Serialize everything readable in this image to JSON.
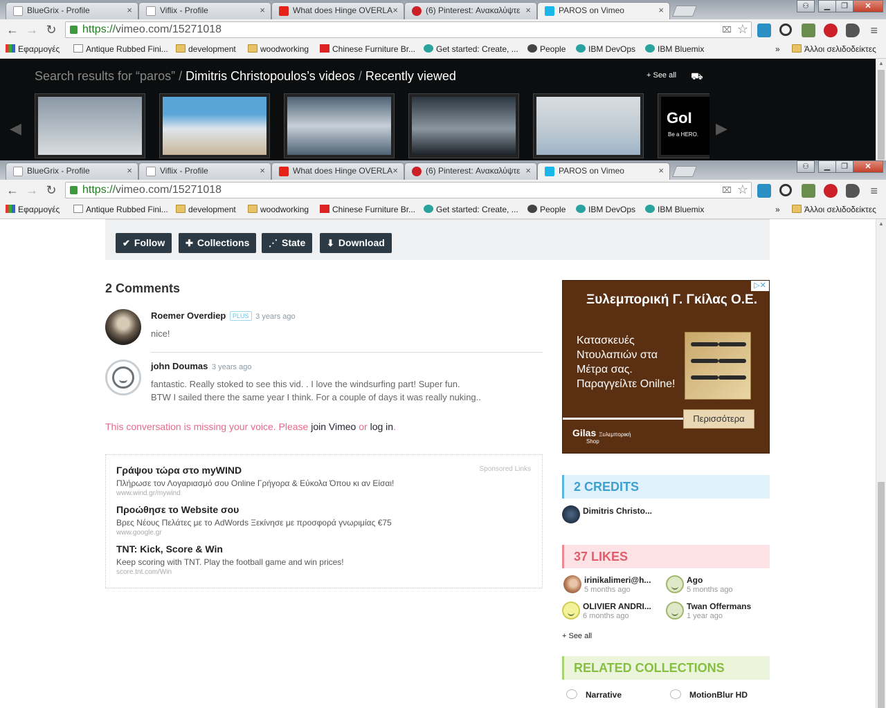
{
  "browser": {
    "tabs": [
      {
        "title": "BlueGrix - Profile",
        "favicon": "page-icon",
        "color": "#ffffff"
      },
      {
        "title": "Viflix - Profile",
        "favicon": "page-icon",
        "color": "#ffffff"
      },
      {
        "title": "What does Hinge OVERLA",
        "favicon": "youtube-icon",
        "color": "#e62117"
      },
      {
        "title": "(6) Pinterest: Ανακαλύψτε",
        "favicon": "pinterest-icon",
        "color": "#cb2027"
      },
      {
        "title": "PAROS on Vimeo",
        "favicon": "vimeo-icon",
        "color": "#1ab7ea"
      }
    ],
    "tab_close": "×",
    "url_scheme": "https://",
    "url_rest": "vimeo.com/15271018",
    "bookmarks": [
      {
        "label": "Εφαρμογές",
        "icon": "apps-icon"
      },
      {
        "label": "Antique Rubbed Fini...",
        "icon": "page-icon"
      },
      {
        "label": "development",
        "icon": "folder-icon"
      },
      {
        "label": "woodworking",
        "icon": "folder-icon"
      },
      {
        "label": "Chinese Furniture Br...",
        "icon": "bookmark-red-icon"
      },
      {
        "label": "Get started: Create, ...",
        "icon": "ibm-icon"
      },
      {
        "label": "People",
        "icon": "github-icon"
      },
      {
        "label": "IBM DevOps",
        "icon": "ibm-icon"
      },
      {
        "label": "IBM Bluemix",
        "icon": "ibm-icon"
      }
    ],
    "bookmarks_overflow": "»",
    "other_bookmarks": "Άλλοι σελιδοδείκτες"
  },
  "carousel": {
    "crumb_1": "Search results for “paros”",
    "sep": " / ",
    "crumb_2": "Dimitris Christopoulos’s videos",
    "crumb_3": "Recently viewed",
    "see_all": "+ See all",
    "thumbs": [
      {
        "name": "paros-town",
        "colors": [
          "#8a98a6",
          "#d9dde0"
        ]
      },
      {
        "name": "windsurf-girls",
        "colors": [
          "#5aa5d8",
          "#c9b79a"
        ]
      },
      {
        "name": "cloudy-sky",
        "colors": [
          "#4e6274",
          "#c7d0d8"
        ]
      },
      {
        "name": "windmill-dusk",
        "colors": [
          "#2b3640",
          "#8a96a0"
        ]
      },
      {
        "name": "beach-blur",
        "colors": [
          "#d7dde2",
          "#9eb4c7"
        ]
      },
      {
        "name": "gopro-ad",
        "colors": [
          "#000000",
          "#1a1a1a"
        ]
      }
    ],
    "gopro_text": "GoI",
    "gopro_sub": "Be a HERO."
  },
  "actions": {
    "follow": "Follow",
    "collections": "Collections",
    "state": "State",
    "download": "Download"
  },
  "comments": {
    "heading": "2 Comments",
    "items": [
      {
        "author": "Roemer Overdiep",
        "badge": "PLUS",
        "time": "3 years ago",
        "text": "nice!"
      },
      {
        "author": "john Doumas",
        "time": "3 years ago",
        "text_1": "fantastic. Really stoked to see this vid. . I love the windsurfing part! Super fun.",
        "text_2": "BTW I sailed there the same year I think. For a couple of days it was really nuking.."
      }
    ],
    "voice_prefix": "This conversation is missing your voice. Please",
    "join": "join Vimeo",
    "or": "or",
    "login": "log in",
    "dot": "."
  },
  "sponsored": {
    "tag": "Sponsored Links",
    "ads": [
      {
        "title": "Γράψου τώρα στο myWIND",
        "desc": "Πλήρωσε τον Λογαριασμό σου Online Γρήγορα & Εύκολα Όπου κι αν Είσαι!",
        "url": "www.wind.gr/mywind"
      },
      {
        "title": "Προώθησε το Website σου",
        "desc": "Βρες Νέους Πελάτες με το AdWords Ξεκίνησε με προσφορά γνωριμίας €75",
        "url": "www.google.gr"
      },
      {
        "title": "TNT: Kick, Score & Win",
        "desc": "Keep scoring with TNT. Play the football game and win prices!",
        "url": "score.tnt.com/Win"
      }
    ]
  },
  "banner": {
    "title": "Ξυλεμπορική Γ. Γκίλας Ο.Ε.",
    "body": "Κατασκευές Ντουλαπιών στα Μέτρα σας. Παραγγείλτε Onilne!",
    "more": "Περισσότερα",
    "logo": "Gilas",
    "logo_sub": "Ξυλεμπορική",
    "logo_shop": "Shop",
    "adchoice": "▷✕"
  },
  "sidebar": {
    "credits_heading": "2 CREDITS",
    "credit_name": "Dimitris Christo...",
    "likes_heading": "37 LIKES",
    "likes": [
      {
        "name": "irinikalimeri@h...",
        "time": "5 months ago",
        "avatar": "photo"
      },
      {
        "name": "Ago",
        "time": "5 months ago",
        "avatar": "face-green"
      },
      {
        "name": "OLIVIER ANDRI...",
        "time": "6 months ago",
        "avatar": "face-yellow"
      },
      {
        "name": "Twan Offermans",
        "time": "1 year ago",
        "avatar": "face-green"
      }
    ],
    "see_all": "+ See all",
    "collections_heading": "RELATED COLLECTIONS",
    "collections": [
      "Narrative",
      "MotionBlur HD"
    ]
  },
  "colors": {
    "vimeo_blue": "#1ab7ea",
    "button_dark": "#2b3a44",
    "voice_pink": "#e8688c"
  }
}
